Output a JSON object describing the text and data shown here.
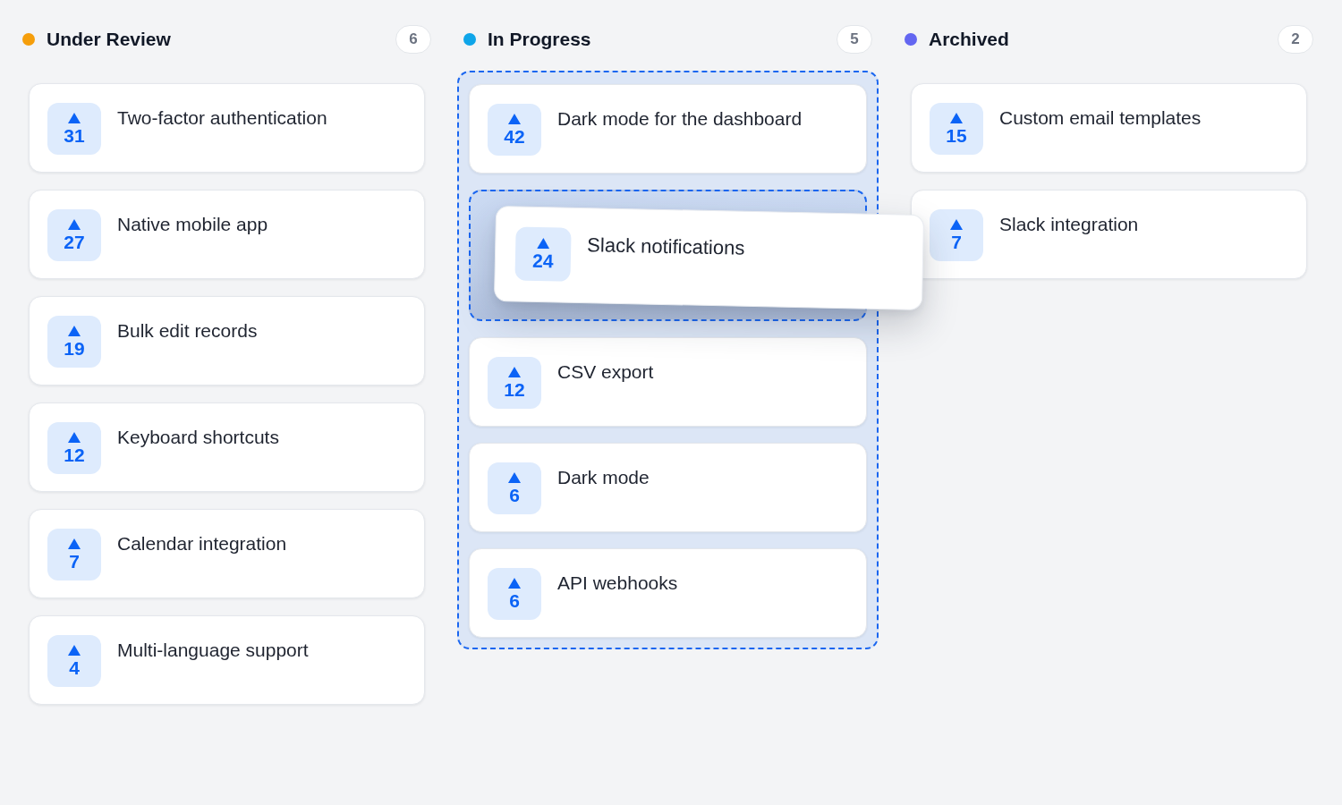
{
  "columns": [
    {
      "title": "Under Review",
      "color": "#f59e0b",
      "count": "6",
      "drop_target": false,
      "cards": [
        {
          "kind": "card",
          "title": "Two-factor authentication",
          "votes": "31"
        },
        {
          "kind": "card",
          "title": "Native mobile app",
          "votes": "27"
        },
        {
          "kind": "card",
          "title": "Bulk edit records",
          "votes": "19"
        },
        {
          "kind": "card",
          "title": "Keyboard shortcuts",
          "votes": "12"
        },
        {
          "kind": "card",
          "title": "Calendar integration",
          "votes": "7"
        },
        {
          "kind": "card",
          "title": "Multi-language support",
          "votes": "4"
        }
      ]
    },
    {
      "title": "In Progress",
      "color": "#0ea5e9",
      "count": "5",
      "drop_target": true,
      "cards": [
        {
          "kind": "card",
          "title": "Dark mode for the dashboard",
          "votes": "42"
        },
        {
          "kind": "drop_slot",
          "dragged_card": {
            "title": "Slack notifications",
            "votes": "24"
          }
        },
        {
          "kind": "card",
          "title": "CSV export",
          "votes": "12"
        },
        {
          "kind": "card",
          "title": "Dark mode",
          "votes": "6"
        },
        {
          "kind": "card",
          "title": "API webhooks",
          "votes": "6"
        }
      ]
    },
    {
      "title": "Archived",
      "color": "#6366f1",
      "count": "2",
      "drop_target": false,
      "cards": [
        {
          "kind": "card",
          "title": "Custom email templates",
          "votes": "15"
        },
        {
          "kind": "card",
          "title": "Slack integration",
          "votes": "7"
        }
      ]
    }
  ]
}
